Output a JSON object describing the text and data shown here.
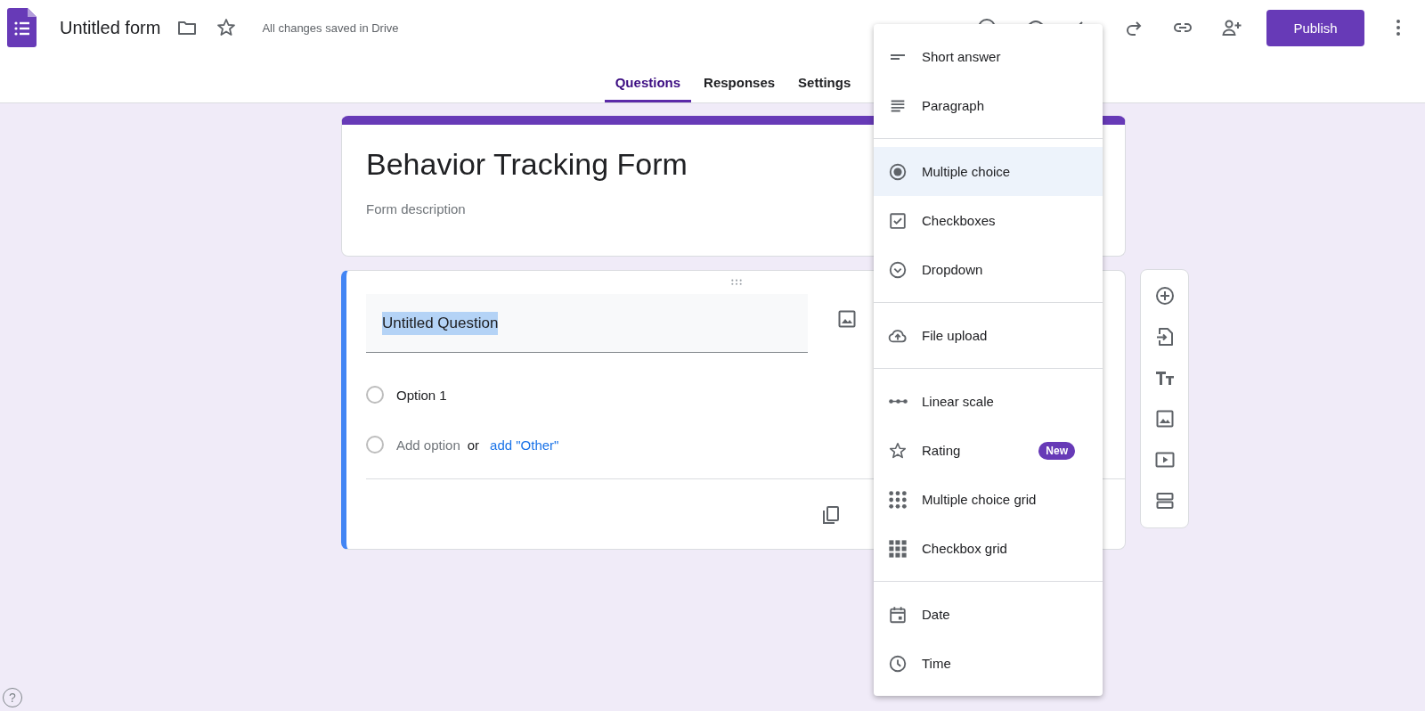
{
  "header": {
    "title": "Untitled form",
    "saved_status": "All changes saved in Drive",
    "publish": "Publish"
  },
  "tabs": [
    {
      "label": "Questions",
      "selected": true
    },
    {
      "label": "Responses",
      "selected": false
    },
    {
      "label": "Settings",
      "selected": false
    }
  ],
  "form": {
    "title": "Behavior Tracking Form",
    "description_placeholder": "Form description"
  },
  "question": {
    "title": "Untitled Question",
    "title_selected": true,
    "options": [
      {
        "label": "Option 1",
        "checked": false
      }
    ],
    "add_option": "Add option",
    "add_option_checked": false,
    "or": "or",
    "add_other": "add \"Other\""
  },
  "type_menu": {
    "sections": [
      {
        "items": [
          {
            "kind": "short-answer",
            "label": "Short answer",
            "selected": false
          },
          {
            "kind": "paragraph",
            "label": "Paragraph",
            "selected": false
          }
        ]
      },
      {
        "items": [
          {
            "kind": "multiple-choice",
            "label": "Multiple choice",
            "selected": true
          },
          {
            "kind": "checkboxes",
            "label": "Checkboxes",
            "selected": false
          },
          {
            "kind": "dropdown",
            "label": "Dropdown",
            "selected": false
          }
        ]
      },
      {
        "items": [
          {
            "kind": "file-upload",
            "label": "File upload",
            "selected": false
          }
        ]
      },
      {
        "items": [
          {
            "kind": "linear-scale",
            "label": "Linear scale",
            "selected": false
          },
          {
            "kind": "rating",
            "label": "Rating",
            "selected": false,
            "badge": "New"
          },
          {
            "kind": "choice-grid",
            "label": "Multiple choice grid",
            "selected": false
          },
          {
            "kind": "checkbox-grid",
            "label": "Checkbox grid",
            "selected": false
          }
        ]
      },
      {
        "items": [
          {
            "kind": "date",
            "label": "Date",
            "selected": false
          },
          {
            "kind": "time",
            "label": "Time",
            "selected": false
          }
        ]
      }
    ]
  },
  "help": "?"
}
